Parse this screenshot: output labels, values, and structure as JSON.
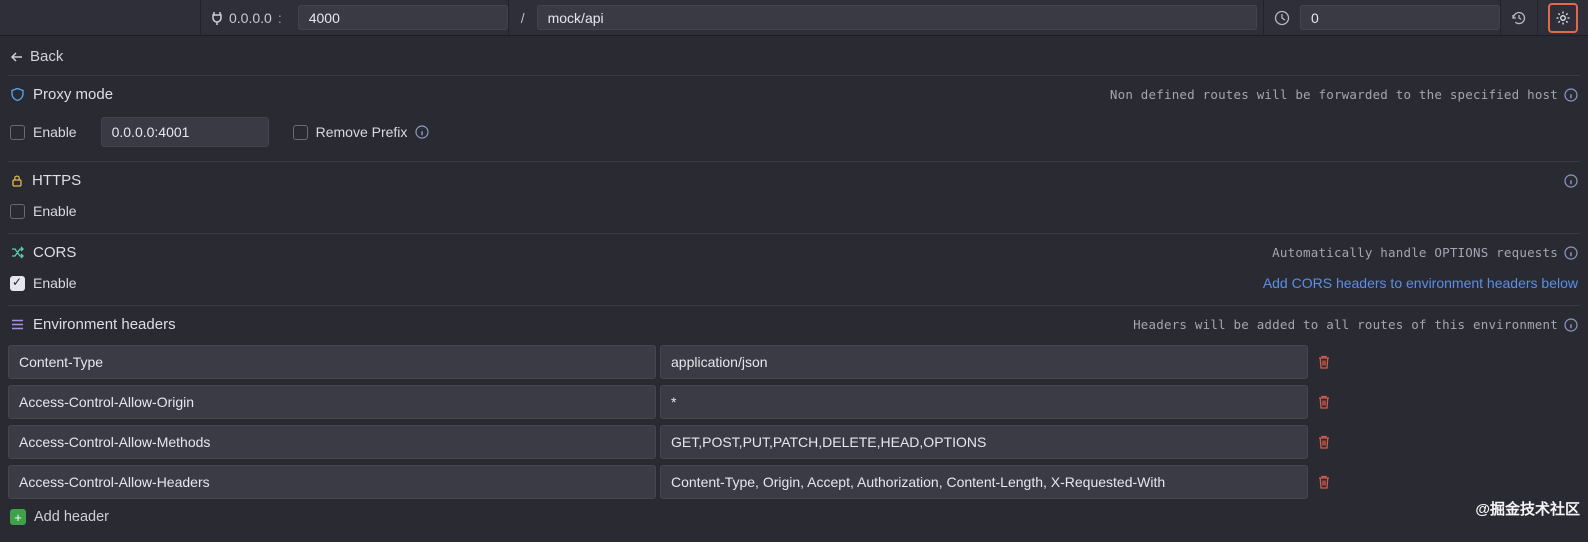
{
  "toolbar": {
    "host_label": "0.0.0.0",
    "port_colon": ":",
    "port_value": "4000",
    "slash": "/",
    "prefix_value": "mock/api",
    "latency_value": "0"
  },
  "nav": {
    "back_label": "Back"
  },
  "proxy": {
    "title": "Proxy mode",
    "note": "Non defined routes will be forwarded to the specified host",
    "enable_label": "Enable",
    "enable_checked": false,
    "host_value": "0.0.0.0:4001",
    "remove_prefix_label": "Remove Prefix",
    "remove_prefix_checked": false
  },
  "https": {
    "title": "HTTPS",
    "enable_label": "Enable",
    "enable_checked": false
  },
  "cors": {
    "title": "CORS",
    "note": "Automatically handle OPTIONS requests",
    "enable_label": "Enable",
    "enable_checked": true,
    "link_label": "Add CORS headers to environment headers below"
  },
  "env_headers": {
    "title": "Environment headers",
    "note": "Headers will be added to all routes of this environment",
    "rows": [
      {
        "key": "Content-Type",
        "value": "application/json"
      },
      {
        "key": "Access-Control-Allow-Origin",
        "value": "*"
      },
      {
        "key": "Access-Control-Allow-Methods",
        "value": "GET,POST,PUT,PATCH,DELETE,HEAD,OPTIONS"
      },
      {
        "key": "Access-Control-Allow-Headers",
        "value": "Content-Type, Origin, Accept, Authorization, Content-Length, X-Requested-With"
      }
    ],
    "add_label": "Add header"
  },
  "watermark": "@掘金技术社区"
}
